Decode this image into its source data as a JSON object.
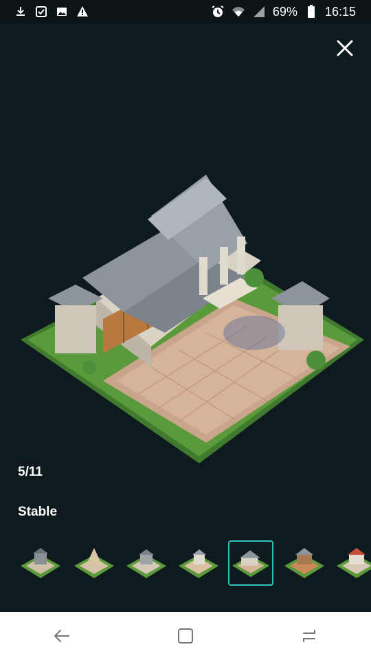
{
  "status_bar": {
    "battery_percent": "69%",
    "time": "16:15",
    "left_icons": [
      "download-icon",
      "checkbox-icon",
      "image-icon",
      "warning-icon"
    ],
    "right_icons": [
      "alarm-icon",
      "wifi-icon",
      "signal-icon",
      "battery-icon"
    ]
  },
  "viewer": {
    "counter": "5/11",
    "title": "Stable",
    "selected_index": 4,
    "thumbnail_count": 7
  },
  "colors": {
    "background": "#0e1a1d",
    "accent": "#2ec4c4",
    "navbar": "#ffffff"
  },
  "nav": {
    "buttons": [
      "back-icon",
      "recents-icon",
      "home-icon"
    ]
  }
}
